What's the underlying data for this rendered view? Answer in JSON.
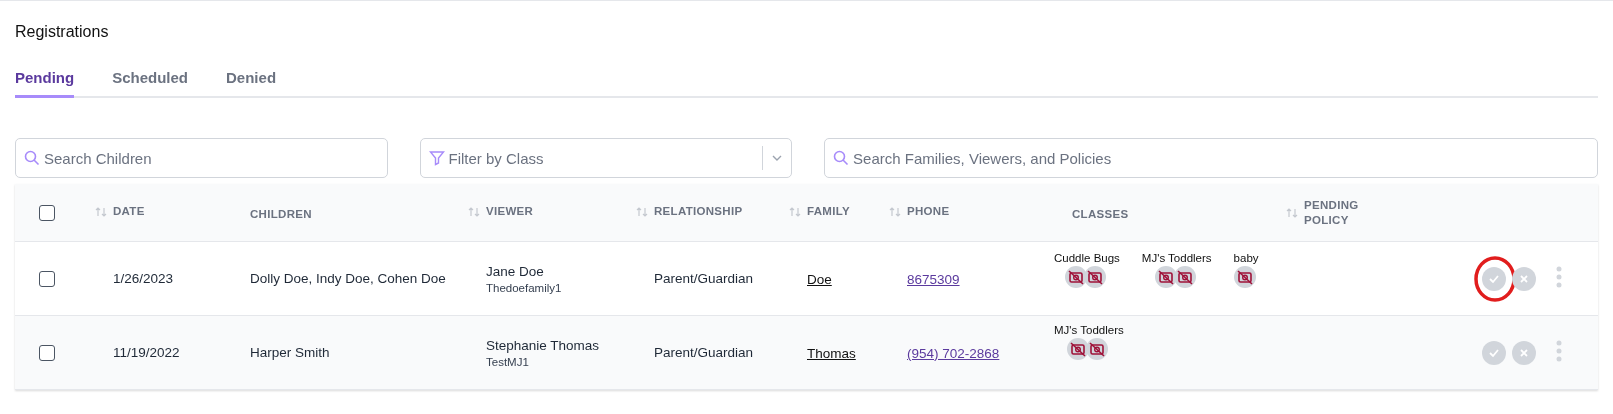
{
  "title": "Registrations",
  "tabs": [
    {
      "label": "Pending",
      "selected": true
    },
    {
      "label": "Scheduled",
      "selected": false
    },
    {
      "label": "Denied",
      "selected": false
    }
  ],
  "filters": [
    {
      "kind": "search",
      "placeholder": "Search Children"
    },
    {
      "kind": "select",
      "placeholder": "Filter by Class"
    },
    {
      "kind": "search",
      "placeholder": "Search Families, Viewers, and Policies"
    }
  ],
  "table": {
    "select_all_checked": false,
    "columns": [
      {
        "label": "DATE",
        "sortable": true
      },
      {
        "label": "CHILDREN",
        "sortable": false
      },
      {
        "label": "VIEWER",
        "sortable": true
      },
      {
        "label": "RELATIONSHIP",
        "sortable": true
      },
      {
        "label": "FAMILY",
        "sortable": true
      },
      {
        "label": "PHONE",
        "sortable": true
      },
      {
        "label": "CLASSES",
        "sortable": false
      },
      {
        "label": "PENDING POLICY",
        "sortable": true
      }
    ],
    "rows": [
      {
        "checked": false,
        "date": "1/26/2023",
        "children": "Dolly Doe, Indy Doe, Cohen Doe",
        "viewer": "Jane Doe",
        "username": "Thedoefamily1",
        "relationship": "Parent/Guardian",
        "family": "Doe",
        "phone": "8675309",
        "classes": [
          {
            "name": "Cuddle Bugs",
            "cameras": [
              {
                "kind": "off"
              },
              {
                "kind": "off"
              }
            ]
          },
          {
            "name": "MJ's Toddlers",
            "cameras": [
              {
                "kind": "off"
              },
              {
                "kind": "off"
              }
            ]
          },
          {
            "name": "baby",
            "cameras": [
              {
                "kind": "off"
              }
            ]
          }
        ],
        "approve_circled": true
      },
      {
        "checked": false,
        "date": "11/19/2022",
        "children": "Harper Smith",
        "viewer": "Stephanie Thomas",
        "username": "TestMJ1",
        "relationship": "Parent/Guardian",
        "family": "Thomas",
        "phone": "(954) 702-2868",
        "classes": [
          {
            "name": "MJ's Toddlers",
            "cameras": [
              {
                "kind": "off"
              },
              {
                "kind": "off"
              }
            ]
          }
        ],
        "approve_circled": false
      }
    ]
  }
}
